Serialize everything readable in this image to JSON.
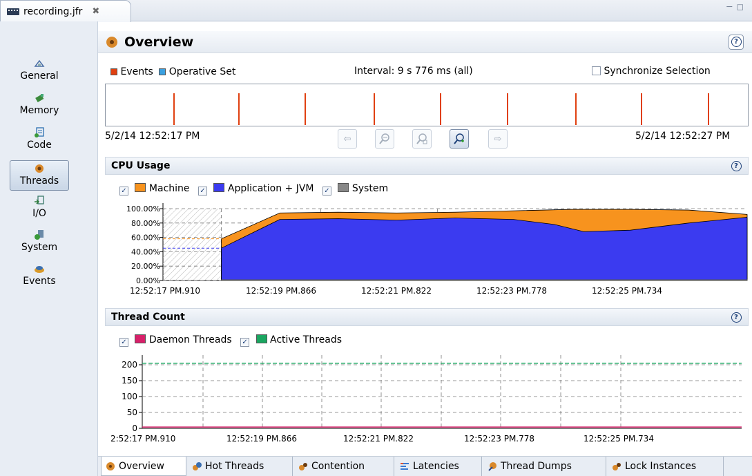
{
  "editor": {
    "tab_title": "recording.jfr",
    "close_glyph": "✖"
  },
  "nav": {
    "items": [
      {
        "label": "General",
        "icon": "general-icon"
      },
      {
        "label": "Memory",
        "icon": "memory-icon"
      },
      {
        "label": "Code",
        "icon": "code-icon"
      },
      {
        "label": "Threads",
        "icon": "threads-icon",
        "selected": true
      },
      {
        "label": "I/O",
        "icon": "io-icon"
      },
      {
        "label": "System",
        "icon": "system-icon"
      },
      {
        "label": "Events",
        "icon": "events-icon"
      }
    ]
  },
  "overview": {
    "title": "Overview",
    "legend_events": "Events",
    "legend_operative": "Operative Set",
    "interval": "Interval: 9 s 776 ms (all)",
    "sync_label": "Synchronize Selection",
    "time_start": "5/2/14 12:52:17 PM",
    "time_end": "5/2/14 12:52:27 PM"
  },
  "cpu": {
    "title": "CPU Usage",
    "legend_machine": "Machine",
    "legend_app": "Application + JVM",
    "legend_system": "System"
  },
  "threads": {
    "title": "Thread Count",
    "legend_daemon": "Daemon Threads",
    "legend_active": "Active Threads"
  },
  "bottom_tabs": [
    "Overview",
    "Hot Threads",
    "Contention",
    "Latencies",
    "Thread Dumps",
    "Lock Instances"
  ],
  "colors": {
    "events": "#e04010",
    "operative": "#3aa0e0",
    "machine": "#f7931e",
    "application": "#3b3bf0",
    "system": "#808080",
    "daemon": "#d8206a",
    "active": "#1aa660"
  },
  "chart_data": [
    {
      "type": "area",
      "name": "CPU Usage",
      "x": [
        "12:52:17 PM.910",
        "12:52:19 PM.866",
        "12:52:21 PM.822",
        "12:52:23 PM.778",
        "12:52:25 PM.734"
      ],
      "yticks": [
        "0.00%",
        "20.00%",
        "40.00%",
        "60.00%",
        "80.00%",
        "100.00%"
      ],
      "ylim": [
        0,
        100
      ],
      "series": [
        {
          "name": "Machine",
          "points": [
            [
              1.0,
              58
            ],
            [
              2.0,
              94
            ],
            [
              3.0,
              95
            ],
            [
              4.0,
              94
            ],
            [
              5.0,
              95
            ],
            [
              6.0,
              97
            ],
            [
              7.0,
              99
            ],
            [
              8.0,
              99
            ],
            [
              9.0,
              98
            ],
            [
              10.0,
              92
            ]
          ]
        },
        {
          "name": "Application + JVM",
          "points": [
            [
              1.0,
              45
            ],
            [
              2.0,
              85
            ],
            [
              3.0,
              86
            ],
            [
              4.0,
              84
            ],
            [
              5.0,
              87
            ],
            [
              6.0,
              85
            ],
            [
              6.7,
              78
            ],
            [
              7.2,
              68
            ],
            [
              8.0,
              70
            ],
            [
              9.0,
              80
            ],
            [
              10.0,
              88
            ]
          ]
        },
        {
          "name": "System",
          "points": [
            [
              1.0,
              1
            ],
            [
              10.0,
              1
            ]
          ]
        }
      ]
    },
    {
      "type": "line",
      "name": "Thread Count",
      "x": [
        "2:52:17 PM.910",
        "12:52:19 PM.866",
        "12:52:21 PM.822",
        "12:52:23 PM.778",
        "12:52:25 PM.734"
      ],
      "yticks": [
        "0",
        "50",
        "100",
        "150",
        "200"
      ],
      "ylim": [
        0,
        220
      ],
      "series": [
        {
          "name": "Active Threads",
          "value": 205
        },
        {
          "name": "Daemon Threads",
          "value": 4
        }
      ]
    }
  ]
}
